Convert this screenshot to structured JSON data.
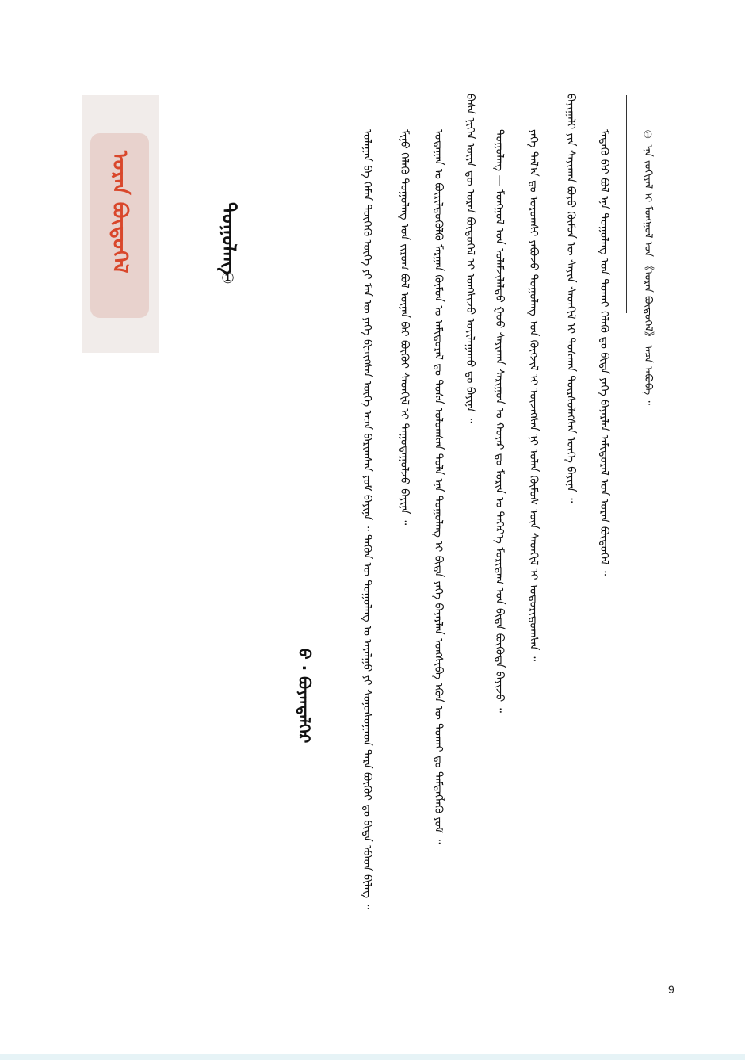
{
  "chapter_tab": {
    "label": "ᠤᠷᠠᠨ ᠪᠦᠲᠦᠭᠡᠯ"
  },
  "title": {
    "text": "ᠳᠤᠭᠤᠯᠠᠩ",
    "footnote_mark": "①"
  },
  "author": {
    "text": "ᠪ · ᠪᠤᠶᠠᠨᠳᠡᠯᠭᠡᠷ"
  },
  "body_columns": [
    "ᠤᠯᠠᠭᠠᠨ ᠪᠠ ᠬᠡᠮᠡᠨ ᠲᠦᠭᠡᠭᠦ ᠦᠭᠡ ᠶᠢ ᠮᠠᠨ ᠦ ᠶᠡᠬᠡ ᠪᠢᠴᠢᠭᠰᠡᠨ ᠦᠭᠡ ᠠᠴᠠ ᠪᠠᠷᠢᠭᠰᠠᠨ ᠶᠤᠮ ᠪᠠᠶᠢᠨᠠ ᠃ ᠲᠡᠭᠦᠨ ᠦ ᠳᠤᠭᠤᠯᠠᠩ ᠤ ᠠᠶᠠᠯᠭᠤ ᠶᠢ ᠰᠣᠨᠣᠰᠤᠭᠠᠳ ᠲᠡᠷᠡ ᠪᠦᠬᠦᠢ ᠳᠤ ᠪᠢᠳᠡ ᠡᠪᠡᠳ ᠪᠢᠯᠡᠭ ᠃",
    "ᠮᠢᠨᠦ ᠬᠡᠯᠡᠬᠦ ᠳᠤᠭᠤᠯᠠᠩ ᠤᠨ ᠵᠢᠷᠤᠭ ᠪᠣᠯ ᠦᠨᠡᠨ ᠪᠡᠷ ᠪᠦᠬᠦᠢ ᠰᠡᠳᠬᠢᠯ ᠢ ᠳᠠᠭᠤᠳᠠᠭᠤᠯᠵᠤ ᠪᠠᠶᠢᠨᠠ ᠃",
    "ᠤᠳᠠᠭᠠᠨ ᠤ ᠪᠦᠷᠢᠯᠳᠦᠭᠦᠯᠬᠦ ᠮᠠᠷᠭᠠᠨ ᠬᠦᠮᠦᠨ ᠤ ᠠᠮᠢᠳᠤᠷᠠᠯ ᠳᠤ ᠲᠤᠰᠠ ᠣᠯᠤᠭᠰᠠᠨ ᠲᠤᠯᠠ ᠡᠨᠡ ᠳᠤᠭᠤᠯᠠᠩ ᠢ ᠪᠢᠳᠡ ᠶᠡᠬᠡ ᠪᠠᠶᠠᠷᠯᠠᠨ ᠤᠩᠰᠢᠪᠠ ᠡᠭᠦᠨ ᠦ ᠲᠤᠬᠠᠢ ᠳᠤ ᠲᠡᠮᠳᠡᠭᠯᠡᠬᠦ ᠶᠤᠮ ᠃",
    "ᠪᠠᠰᠠ ᠨᠢᠭᠡᠨ ᠦᠶᠡ ᠳᠦ ᠤᠷᠠᠨ ᠪᠦᠲᠦᠭᠡᠯ ᠢ ᠤᠩᠰᠢᠵᠤ ᠣᠶᠢᠯᠠᠭᠠᠬᠤ ᠳᠤ ᠪᠠᠶᠢᠨᠠ ᠃",
    "ᠳᠤᠭᠤᠯᠠᠩ — ᠮᠣᠩᠭᠣᠯ ᠤᠨ ᠤᠯᠠᠮᠵᠢᠯᠠᠯᠲᠤ ᠭᠣᠣ ᠰᠠᠶᠢᠬᠠᠨ ᠰᠠᠷᠢᠭᠤᠨ ᠤ ᠬᠣᠶᠠᠷ ᠳᠤ ᠮᠣᠷᠢᠨ ᠤ ᠳᠡᠭᠡᠷ᠎ᠡ ᠮᠣᠷᠢᠳᠠᠭ ᠤᠨ ᠪᠢᠳᠡ ᠪᠦᠭᠦᠳᠡ ᠪᠠᠶᠢᠵᠤ ᠃",
    "ᠶᠡᠬᠡ ᠲᠠᠯ᠎ᠠ ᠳᠤ ᠤᠷᠤᠭᠰᠢ ᠶᠠᠪᠤᠵᠤ ᠳᠤᠭᠤᠯᠠᠩ ᠤᠨ ᠬᠥᠭᠵᠢᠯ ᠢ ᠦᠵᠡᠭᠰᠡᠨ ᠨᠢ ᠣᠯᠠᠨ ᠬᠦᠮᠦᠰ ᠦᠨ ᠰᠡᠳᠬᠢᠯ ᠢ ᠤᠳᠤᠷᠢᠳᠤᠭᠰᠠᠨ ᠃",
    "ᠪᠠᠶᠢᠭᠠᠯᠢ ᠶᠢᠨ ᠰᠠᠶᠢᠬᠠᠨ ᠪᠤᠶᠤ ᠬᠦᠮᠦᠨ ᠦ ᠰᠠᠶᠢᠨ ᠰᠡᠳᠬᠢᠯ ᠢ ᠲᠤᠰᠬᠠᠨ ᠳᠦᠷᠰᠦᠯᠡᠭᠰᠡᠨ ᠦᠭᠡ ᠪᠠᠶᠢᠨᠠ ᠃",
    "ᠮᠡᠳᠡᠬᠦ ᠪᠠᠷ ᠪᠣᠯ ᠡᠨᠡ ᠳᠤᠭᠤᠯᠠᠩ ᠤᠨ ᠲᠤᠬᠠᠢ ᠬᠡᠯᠡᠬᠦ ᠳᠤ ᠪᠢᠳᠡ ᠶᠡᠬᠡ ᠪᠠᠶᠠᠷᠯᠠᠨ ᠠᠮᠢᠳᠤᠷᠠᠯ ᠤᠨ ᠤᠷᠠᠨ ᠪᠦᠲᠦᠭᠡᠯ ᠃"
  ],
  "footnote": {
    "mark": "①",
    "text": "ᠡᠨᠡ ᠵᠣᠬᠢᠶᠠᠯ ᠢ ᠮᠣᠩᠭᠣᠯ ᠤᠨ 《ᠤᠷᠠᠨ ᠪᠦᠲᠦᠭᠡᠯ》 ᠠᠴᠠ ᠠᠪᠤᠪᠠ ᠃"
  },
  "page_number": "9"
}
